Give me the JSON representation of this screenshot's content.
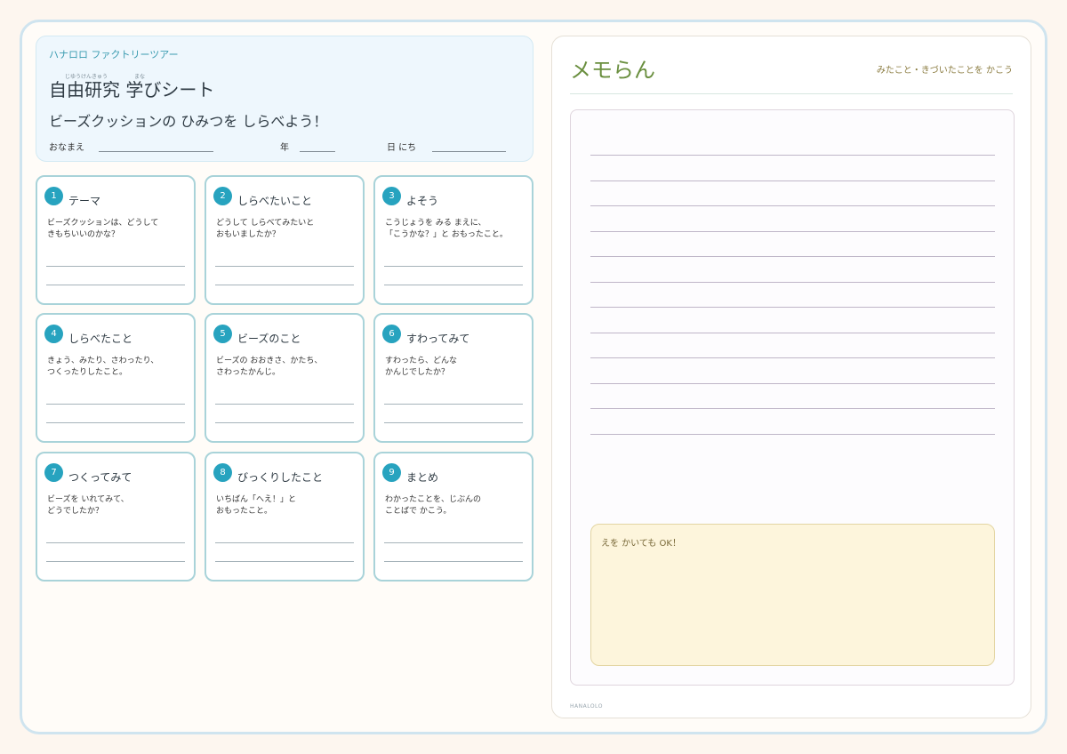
{
  "header": {
    "brand": "ハナロロ ファクトリーツアー",
    "title": "自由研究 学びシート",
    "ruby": [
      "じゆうけんきゅう",
      "まな"
    ],
    "subtitle": "ビーズクッションの ひみつを しらべよう！",
    "fields": {
      "name_label": "おなまえ",
      "grade_label": "年",
      "date_label": "日 にち"
    }
  },
  "cards": [
    {
      "num": "1",
      "title": "テーマ",
      "desc": "ビーズクッションは、どうして\nきもちいいのかな？"
    },
    {
      "num": "2",
      "title": "しらべたいこと",
      "desc": "どうして しらべてみたいと\nおもいましたか？"
    },
    {
      "num": "3",
      "title": "よそう",
      "desc": "こうじょうを みる まえに、\n「こうかな？」と おもったこと。"
    },
    {
      "num": "4",
      "title": "しらべたこと",
      "desc": "きょう、みたり、さわったり、\nつくったりしたこと。"
    },
    {
      "num": "5",
      "title": "ビーズのこと",
      "desc": "ビーズの おおきさ、かたち、\nさわったかんじ。"
    },
    {
      "num": "6",
      "title": "すわってみて",
      "desc": "すわったら、どんな\nかんじでしたか？"
    },
    {
      "num": "7",
      "title": "つくってみて",
      "desc": "ビーズを いれてみて、\nどうでしたか？"
    },
    {
      "num": "8",
      "title": "びっくりしたこと",
      "desc": "いちばん「へえ！」と\nおもったこと。"
    },
    {
      "num": "9",
      "title": "まとめ",
      "desc": "わかったことを、じぶんの\nことばで かこう。"
    }
  ],
  "memo": {
    "title": "メモらん",
    "note": "みたこと・きづいたことを かこう",
    "draw_label": "えを かいても OK！",
    "footer": "HANALOLO"
  },
  "colors": {
    "accent": "#27a3bf",
    "memo_title": "#6a8f3f",
    "card_border": "#a9d3d9"
  }
}
